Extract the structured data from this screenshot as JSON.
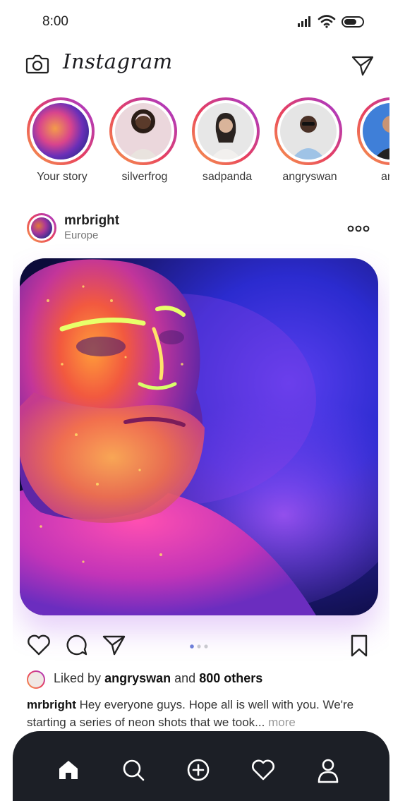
{
  "status_bar": {
    "time": "8:00",
    "signal_icon": "signal-icon",
    "wifi_icon": "wifi-icon",
    "battery_icon": "battery-icon"
  },
  "header": {
    "logo": "Instagram",
    "camera_icon": "camera-icon",
    "direct_icon": "paper-plane-icon"
  },
  "stories": [
    {
      "label": "Your story"
    },
    {
      "label": "silverfrog"
    },
    {
      "label": "sadpanda"
    },
    {
      "label": "angryswan"
    },
    {
      "label": "anro"
    }
  ],
  "post": {
    "username": "mrbright",
    "location": "Europe",
    "more_icon": "more-dots-icon",
    "liked_prefix": "Liked by",
    "liked_user": "angryswan",
    "liked_and": "and",
    "liked_count": "800 others",
    "caption_user": "mrbright",
    "caption_text": "Hey everyone guys. Hope all is well with you. We're starting a series of neon shots that we took...",
    "caption_more": "more",
    "carousel_pages": 3,
    "carousel_active": 1
  },
  "nav": [
    {
      "name": "home-icon"
    },
    {
      "name": "search-icon"
    },
    {
      "name": "add-icon"
    },
    {
      "name": "heart-icon"
    },
    {
      "name": "profile-icon"
    }
  ],
  "colors": {
    "story_gradient": [
      "#f7a04b",
      "#e8405e",
      "#a138d6"
    ],
    "nav_bg": "#1c1f26"
  }
}
